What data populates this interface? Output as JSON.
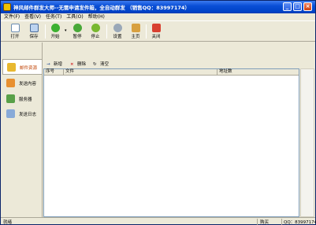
{
  "window": {
    "title": "神风邮件群发大师--无需申请发件箱，全自动群发  （销售QQ：83997174）",
    "controls": {
      "minimize": "_",
      "maximize": "□",
      "close": "×"
    }
  },
  "menu": [
    "文件(F)",
    "查看(V)",
    "任务(T)",
    "工具(O)",
    "帮助(H)"
  ],
  "toolbar": {
    "open": "打开",
    "save": "保存",
    "start": "开始",
    "start_dropdown": "▾",
    "pause": "暂停",
    "stop": "停止",
    "settings": "设置",
    "home": "主页",
    "close": "关闭"
  },
  "sidebar": {
    "items": [
      {
        "label": "邮件资源",
        "icon": "mail-resource-icon"
      },
      {
        "label": "发送内容",
        "icon": "send-content-icon"
      },
      {
        "label": "服务器",
        "icon": "server-icon"
      },
      {
        "label": "发送日志",
        "icon": "send-log-icon"
      }
    ]
  },
  "list_toolbar": {
    "add": "新增",
    "delete": "删除",
    "clear": "清空"
  },
  "table": {
    "columns": [
      "序号",
      "文件",
      "地址数"
    ]
  },
  "status": {
    "left": "就绪",
    "home": "购买",
    "qq": "QQ：83997174"
  },
  "colors": {
    "title_bar": "#0A4FD6",
    "chrome": "#ECE9D8",
    "active_nav_text": "#C04000"
  }
}
